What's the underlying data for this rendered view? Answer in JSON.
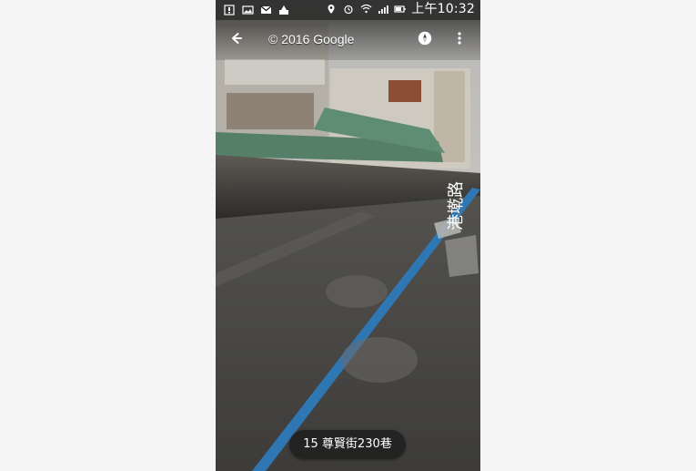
{
  "status_bar": {
    "time": "上午10:32",
    "icons_left": [
      "notification-square-icon",
      "gallery-icon",
      "mail-icon",
      "app-icon"
    ],
    "icons_right": [
      "location-icon",
      "alarm-icon",
      "wifi-icon",
      "signal-icon",
      "battery-icon"
    ]
  },
  "toolbar": {
    "copyright": "© 2016 Google",
    "back_icon": "arrow-back-icon",
    "compass_icon": "compass-icon",
    "menu_icon": "more-vert-icon"
  },
  "street_view": {
    "road_label": "港墘路",
    "location_label": "15 尊賢街230巷"
  },
  "colors": {
    "statusbar_bg": "#1a1a1a",
    "pill_bg": "#1e1e1e",
    "text_light": "#ffffff"
  }
}
